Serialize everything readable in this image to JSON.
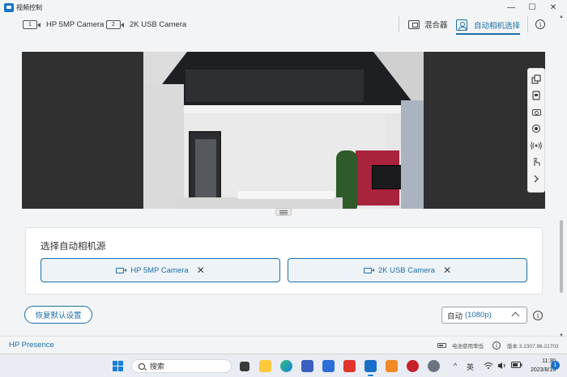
{
  "window": {
    "title": "视频控制",
    "controls": [
      "—",
      "☐",
      "✕"
    ]
  },
  "toolbar": {
    "cameras": [
      {
        "index": "1",
        "label": "HP 5MP Camera"
      },
      {
        "index": "2",
        "label": "2K USB Camera"
      }
    ],
    "mixer_label": "混合器",
    "auto_select_label": "自动相机选择",
    "info_glyph": "i"
  },
  "preview": {
    "side_tools": [
      {
        "name": "pip-icon"
      },
      {
        "name": "snapshot-icon"
      },
      {
        "name": "camera-icon"
      },
      {
        "name": "record-icon"
      },
      {
        "name": "broadcast-icon"
      },
      {
        "name": "touch-icon"
      },
      {
        "name": "expand-icon"
      }
    ]
  },
  "source_panel": {
    "title": "选择自动相机源",
    "sources": [
      {
        "label": "HP 5MP Camera",
        "remove_glyph": "✕"
      },
      {
        "label": "2K USB Camera",
        "remove_glyph": "✕"
      }
    ]
  },
  "controls": {
    "reset_label": "恢复默认设置",
    "resolution_prefix": "自动",
    "resolution_value": "(1080p)",
    "info_glyph": "i"
  },
  "footer": {
    "brand": "HP Presence",
    "power_text": "电池使用率低",
    "version_text": "版本 3.2307.96.21703",
    "info_glyph": "i"
  },
  "taskbar": {
    "search_placeholder": "搜索",
    "ime": "英",
    "time": "11:30",
    "date": "2023/8/16",
    "notification_count": "1",
    "tray_up_glyph": "^",
    "colors": {
      "accent": "#1a7fd6",
      "brand_blue": "#1a6fa8"
    }
  }
}
